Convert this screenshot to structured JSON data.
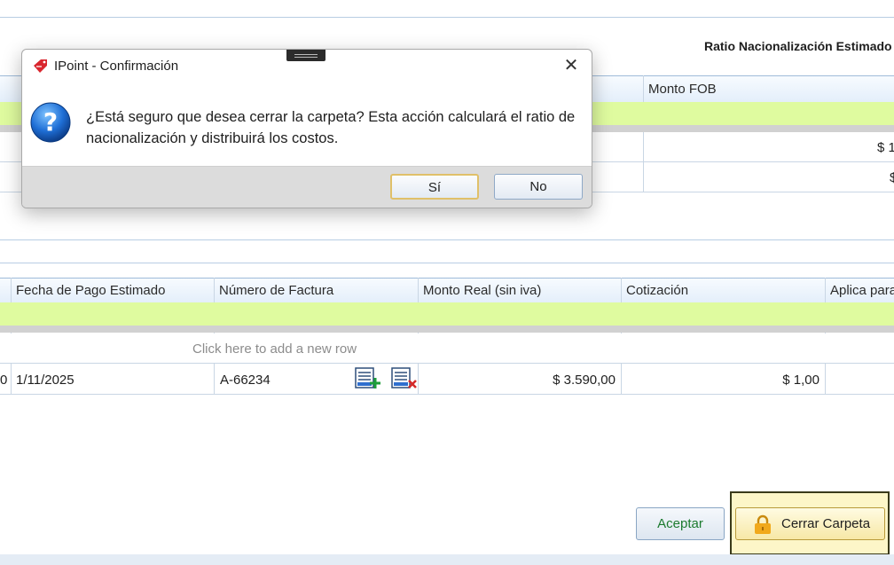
{
  "top_panel": {
    "ratio_label": "Ratio Nacionalización Estimado",
    "monto_fob_header": "Monto FOB",
    "row1_value": "$ 1",
    "row2_value": "$"
  },
  "payments_grid": {
    "columns": [
      "Fecha de Pago Estimado",
      "Número de Factura",
      "Monto Real (sin iva)",
      "Cotización",
      "Aplica para"
    ],
    "new_row_hint": "Click here to add a new row",
    "rows": [
      {
        "lead": "0",
        "fecha": "1/11/2025",
        "factura": "A-66234",
        "monto": "$ 3.590,00",
        "cotizacion": "$ 1,00"
      }
    ]
  },
  "actions": {
    "accept_label": "Aceptar",
    "close_folder_label": "Cerrar Carpeta"
  },
  "dialog": {
    "title": "IPoint - Confirmación",
    "message_line1": "¿Está seguro que desea cerrar la carpeta? Esta acción calculará el ratio de",
    "message_line2": "nacionalización y distribuirá los costos.",
    "yes_label": "Sí",
    "no_label": "No"
  },
  "colors": {
    "filter_row": "#dffb9f",
    "header_gradient_bottom": "#e3eefa",
    "highlight_border": "#3a3a1a",
    "highlight_fill": "#fdf6c8",
    "lock_icon": "#f1a91b"
  }
}
